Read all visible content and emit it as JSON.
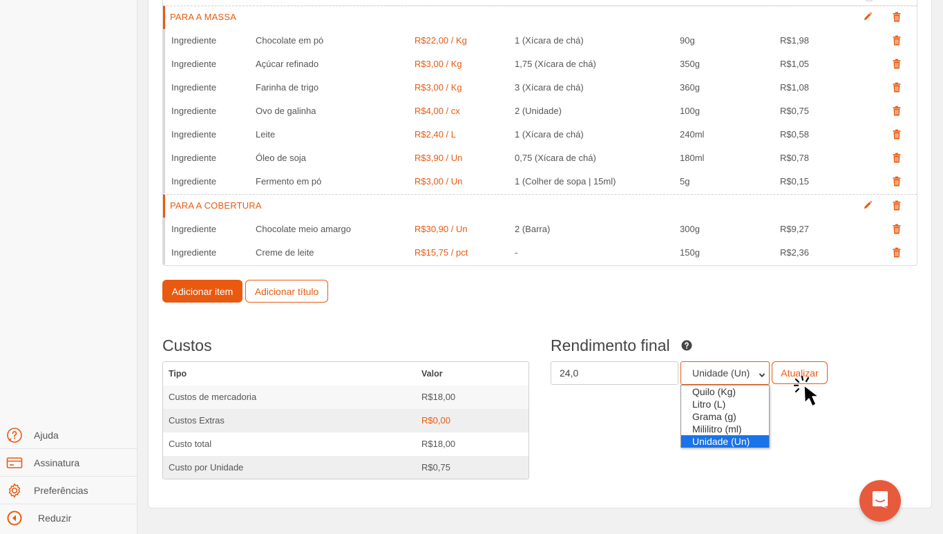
{
  "sidebar": {
    "items": [
      {
        "label": "Ajuda",
        "icon": "help-icon"
      },
      {
        "label": "Assinatura",
        "icon": "credit-card-icon"
      },
      {
        "label": "Preferências",
        "icon": "gear-icon"
      },
      {
        "label": "Reduzir",
        "icon": "collapse-icon"
      }
    ]
  },
  "recipe": {
    "sections": [
      {
        "title": "PARA A MASSA",
        "items": [
          {
            "tipo": "Ingrediente",
            "nome": "Chocolate em pó",
            "preco": "R$22,00 / Kg",
            "quantidade": "1 (Xícara de chá)",
            "peso": "90g",
            "custo": "R$1,98"
          },
          {
            "tipo": "Ingrediente",
            "nome": "Açúcar refinado",
            "preco": "R$3,00 / Kg",
            "quantidade": "1,75 (Xícara de chá)",
            "peso": "350g",
            "custo": "R$1,05"
          },
          {
            "tipo": "Ingrediente",
            "nome": "Farinha de trigo",
            "preco": "R$3,00 / Kg",
            "quantidade": "3 (Xícara de chá)",
            "peso": "360g",
            "custo": "R$1,08"
          },
          {
            "tipo": "Ingrediente",
            "nome": "Ovo de galinha",
            "preco": "R$4,00 / cx",
            "quantidade": "2 (Unidade)",
            "peso": "100g",
            "custo": "R$0,75"
          },
          {
            "tipo": "Ingrediente",
            "nome": "Leite",
            "preco": "R$2,40 / L",
            "quantidade": "1 (Xícara de chá)",
            "peso": "240ml",
            "custo": "R$0,58"
          },
          {
            "tipo": "Ingrediente",
            "nome": "Óleo de soja",
            "preco": "R$3,90 / Un",
            "quantidade": "0,75 (Xícara de chá)",
            "peso": "180ml",
            "custo": "R$0,78"
          },
          {
            "tipo": "Ingrediente",
            "nome": "Fermento em pó",
            "preco": "R$3,00 / Un",
            "quantidade": "1 (Colher de sopa | 15ml)",
            "peso": "5g",
            "custo": "R$0,15"
          }
        ]
      },
      {
        "title": "PARA A COBERTURA",
        "items": [
          {
            "tipo": "Ingrediente",
            "nome": "Chocolate meio amargo",
            "preco": "R$30,90 / Un",
            "quantidade": "2 (Barra)",
            "peso": "300g",
            "custo": "R$9,27"
          },
          {
            "tipo": "Ingrediente",
            "nome": "Creme de leite",
            "preco": "R$15,75 / pct",
            "quantidade": "-",
            "peso": "150g",
            "custo": "R$2,36"
          }
        ]
      }
    ]
  },
  "actions": {
    "add_item": "Adicionar item",
    "add_title": "Adicionar título"
  },
  "costs": {
    "heading": "Custos",
    "columns": [
      "Tipo",
      "Valor"
    ],
    "rows": [
      {
        "tipo": "Custos de mercadoria",
        "valor": "R$18,00"
      },
      {
        "tipo": "Custos Extras",
        "valor": "R$0,00"
      },
      {
        "tipo": "Custo total",
        "valor": "R$18,00"
      },
      {
        "tipo": "Custo por Unidade",
        "valor": "R$0,75"
      }
    ]
  },
  "yield": {
    "heading": "Rendimento final",
    "value": "24,0",
    "unit_selected": "Unidade (Un)",
    "unit_options": [
      "Quilo (Kg)",
      "Litro (L)",
      "Grama (g)",
      "Mililitro (ml)",
      "Unidade (Un)"
    ],
    "update_button": "Atualizar"
  },
  "colors": {
    "accent": "#e85a10",
    "chat": "#e85a3c",
    "selected_option": "#1a73e8"
  }
}
